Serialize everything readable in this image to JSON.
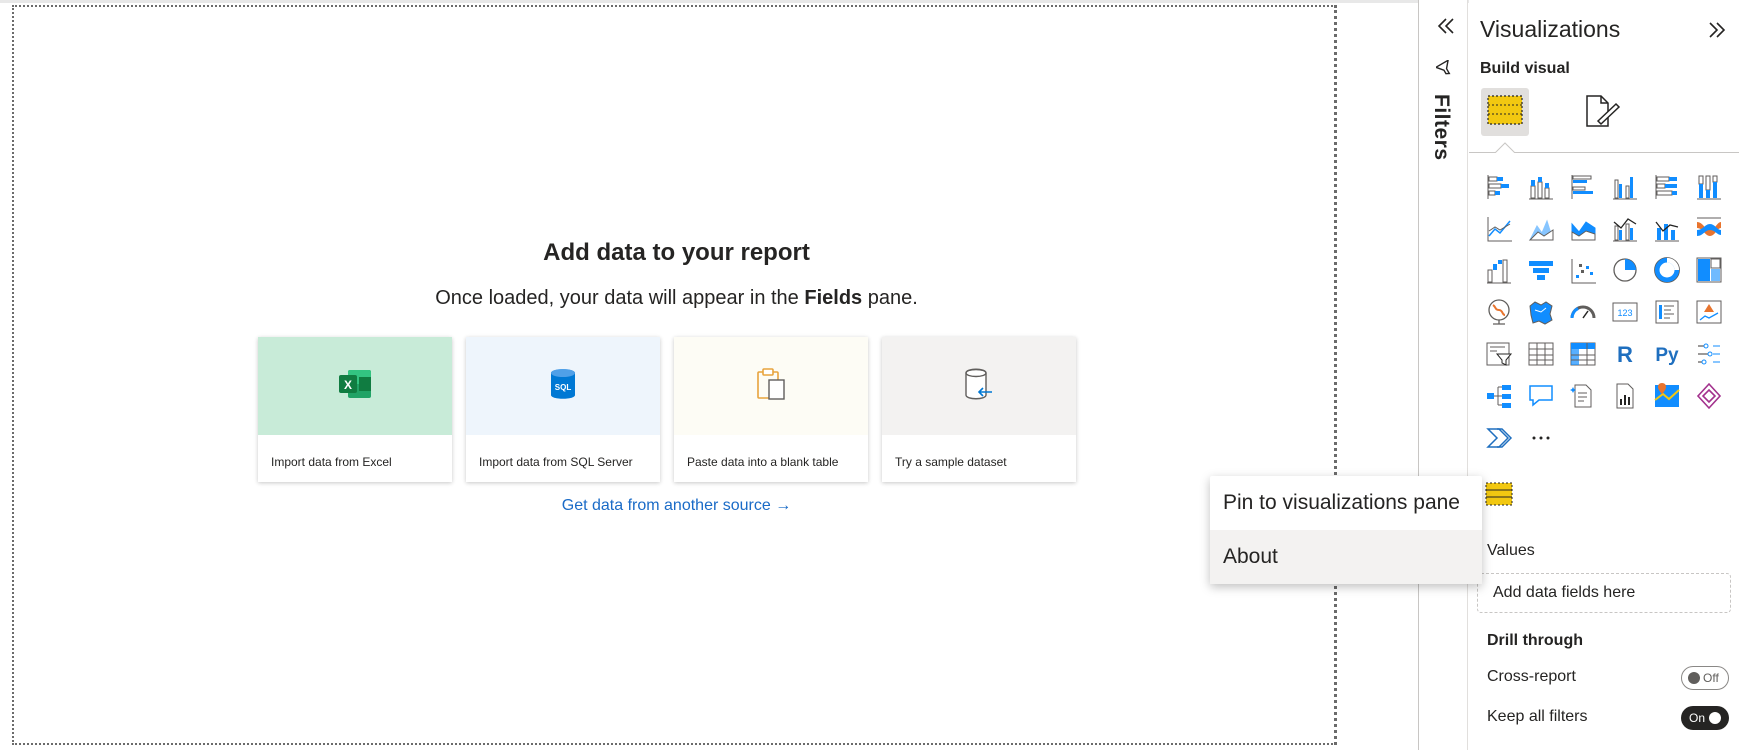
{
  "canvas": {
    "empty_state": {
      "title": "Add data to your report",
      "subtitle_prefix": "Once loaded, your data will appear in the ",
      "subtitle_bold": "Fields",
      "subtitle_suffix": " pane."
    },
    "cards": [
      {
        "label": "Import data from Excel",
        "icon": "excel-icon",
        "bg": "#c8ebd8"
      },
      {
        "label": "Import data from SQL Server",
        "icon": "sql-server-icon",
        "bg": "#eef5fc"
      },
      {
        "label": "Paste data into a blank table",
        "icon": "paste-icon",
        "bg": "#fdfcf5"
      },
      {
        "label": "Try a sample dataset",
        "icon": "sample-dataset-icon",
        "bg": "#f3f2f1"
      }
    ],
    "get_data_link": "Get data from another source →"
  },
  "filters": {
    "label": "Filters",
    "expand_icon": "chevron-double-left-icon",
    "filter_icon": "filter-icon"
  },
  "visualizations": {
    "title": "Visualizations",
    "collapse_icon": "chevron-double-right-icon",
    "build_visual_label": "Build visual",
    "tabs": [
      "build-visual-icon",
      "format-visual-icon"
    ],
    "visual_icons": [
      "stacked-bar-chart-icon",
      "stacked-column-chart-icon",
      "clustered-bar-chart-icon",
      "clustered-column-chart-icon",
      "100-stacked-bar-chart-icon",
      "100-stacked-column-chart-icon",
      "line-chart-icon",
      "area-chart-icon",
      "stacked-area-chart-icon",
      "line-clustered-column-chart-icon",
      "line-stacked-column-chart-icon",
      "ribbon-chart-icon",
      "waterfall-chart-icon",
      "funnel-chart-icon",
      "scatter-chart-icon",
      "pie-chart-icon",
      "donut-chart-icon",
      "treemap-icon",
      "map-icon",
      "filled-map-icon",
      "gauge-icon",
      "card-icon",
      "multi-row-card-icon",
      "kpi-icon",
      "slicer-icon",
      "table-icon",
      "matrix-icon",
      "r-script-visual-icon",
      "python-visual-icon",
      "key-influencers-icon",
      "decomposition-tree-icon",
      "qa-icon",
      "smart-narrative-icon",
      "paginated-report-icon",
      "azure-map-icon",
      "power-apps-icon",
      "power-automate-icon",
      "more-visuals-icon"
    ],
    "selected_visual_icon": "table-visual-icon",
    "values_label": "Values",
    "values_placeholder": "Add data fields here",
    "drill_through_label": "Drill through",
    "cross_report_label": "Cross-report",
    "cross_report_toggle": "Off",
    "keep_filters_label": "Keep all filters",
    "keep_filters_toggle": "On"
  },
  "context_menu": {
    "items": [
      "Pin to visualizations pane",
      "About"
    ],
    "hovered_item": "About"
  },
  "colors": {
    "accent_link": "#1a6bc7",
    "excel_green": "#107c41",
    "sql_blue": "#0078d4",
    "viz_blue": "#118dff",
    "viz_yellow": "#f2c811"
  }
}
